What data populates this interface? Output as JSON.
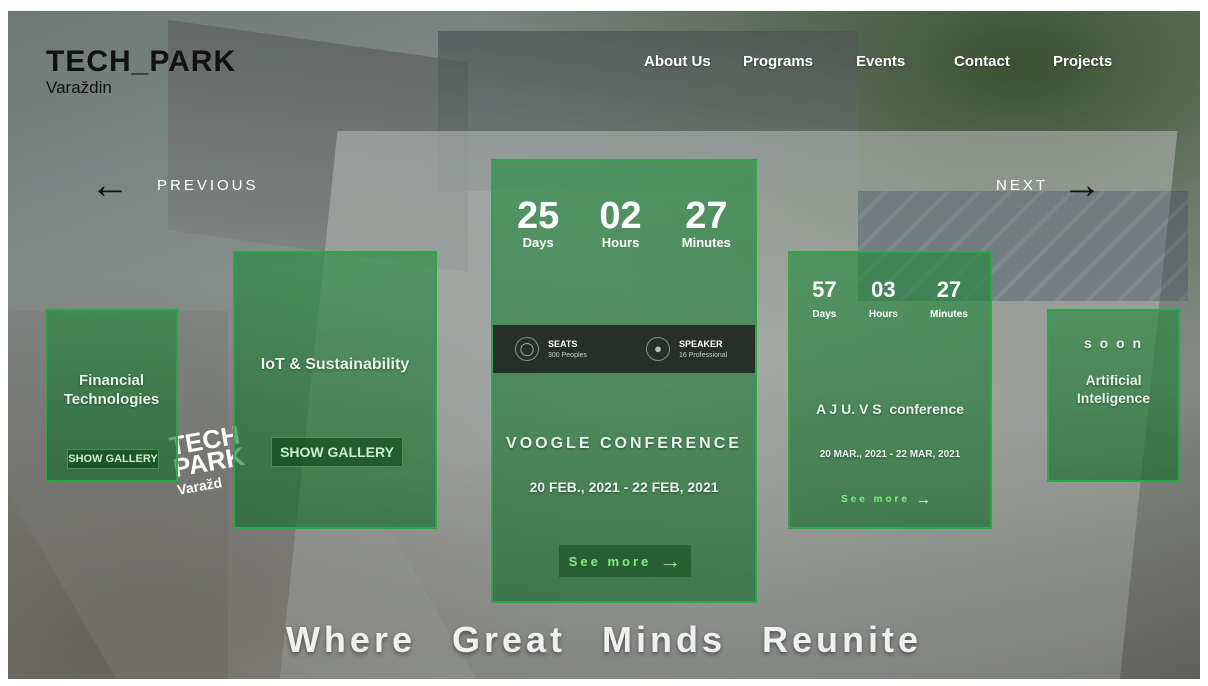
{
  "header": {
    "logo_title": "TECH_PARK",
    "logo_subtitle": "Varaždin",
    "nav": [
      "About Us",
      "Programs",
      "Events",
      "Contact",
      "Projects"
    ]
  },
  "pager": {
    "previous": "PREVIOUS",
    "next": "NEXT"
  },
  "cards": {
    "financial": {
      "title": "Financial Technologies",
      "button": "SHOW GALLERY"
    },
    "iot": {
      "title": "IoT & Sustainability",
      "button": "SHOW GALLERY"
    },
    "voogle": {
      "countdown": [
        {
          "value": "25",
          "label": "Days"
        },
        {
          "value": "02",
          "label": "Hours"
        },
        {
          "value": "27",
          "label": "Minutes"
        }
      ],
      "seats_label": "SEATS",
      "seats_value": "300 Peoples",
      "speaker_label": "SPEAKER",
      "speaker_value": "16 Professional",
      "title": "VOOGLE CONFERENCE",
      "dates": "20 FEB., 2021 - 22 FEB, 2021",
      "see_more": "See more"
    },
    "ajuvs": {
      "countdown": [
        {
          "value": "57",
          "label": "Days"
        },
        {
          "value": "03",
          "label": "Hours"
        },
        {
          "value": "27",
          "label": "Minutes"
        }
      ],
      "title": "A J U. V S  conference",
      "dates": "20 MAR., 2021 - 22 MAR, 2021",
      "see_more": "See more"
    },
    "ai": {
      "badge": "s o o n",
      "title": "Artificial Inteligence"
    }
  },
  "watermark": {
    "line1": "TECH",
    "line2": "PARK",
    "line3": "Varažd"
  },
  "tagline": "Where Great Minds Reunite",
  "colors": {
    "card_green": "#1c963a",
    "see_more_green": "#7cf07c",
    "stats_bar": "#1e1e20"
  },
  "icons": {
    "prev": "arrow-left-icon",
    "next": "arrow-right-icon",
    "seats": "user-icon",
    "speaker": "microphone-icon"
  }
}
